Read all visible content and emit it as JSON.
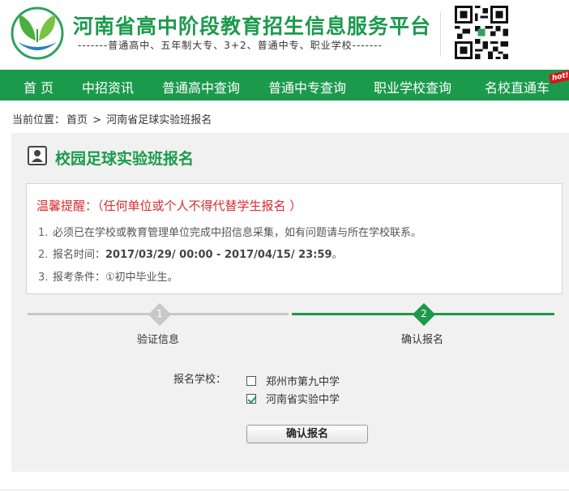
{
  "header": {
    "title": "河南省高中阶段教育招生信息服务平台",
    "subtitle": "-------普通高中、五年制大专、3+2、普通中专、职业学校-------"
  },
  "nav": {
    "items": [
      "首 页",
      "中招资讯",
      "普通高中查询",
      "普通中专查询",
      "职业学校查询",
      "名校直通车"
    ],
    "hot_badge": "hot!"
  },
  "breadcrumb": {
    "prefix": "当前位置：",
    "home": "首页",
    "separator": ">",
    "current": "河南省足球实验班报名"
  },
  "page": {
    "title": "校园足球实验班报名"
  },
  "notice": {
    "title": "温馨提醒：（任何单位或个人不得代替学生报名 ）",
    "items": [
      {
        "num": "1.",
        "text": "必须已在学校或教育管理单位完成中招信息采集，如有问题请与所在学校联系。"
      },
      {
        "num": "2.",
        "label": "报名时间：",
        "value": "2017/03/29/ 00:00 - 2017/04/15/ 23:59",
        "suffix": "。"
      },
      {
        "num": "3.",
        "text": "报考条件：①初中毕业生。"
      }
    ]
  },
  "steps": [
    {
      "num": "1",
      "label": "验证信息",
      "state": "inactive"
    },
    {
      "num": "2",
      "label": "确认报名",
      "state": "active"
    }
  ],
  "form": {
    "label": "报名学校：",
    "options": [
      {
        "label": "郑州市第九中学",
        "checked": false
      },
      {
        "label": "河南省实验中学",
        "checked": true
      }
    ],
    "submit_label": "确认报名"
  },
  "colors": {
    "brand_green": "#1c9a4c",
    "notice_red": "#d92b2b",
    "hot_red": "#d9141b",
    "panel_bg": "#f1f1f1"
  }
}
